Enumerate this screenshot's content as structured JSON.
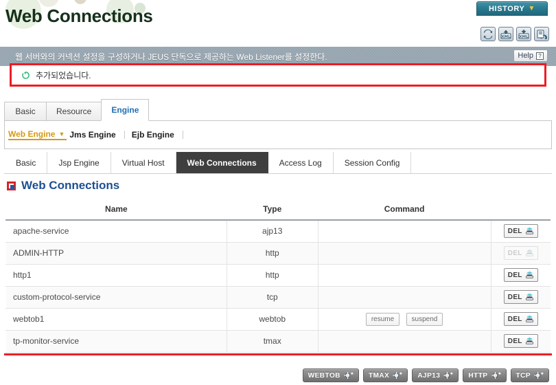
{
  "header": {
    "title": "Web Connections",
    "history_label": "HISTORY",
    "history_caret": "▼",
    "toolbar_icons": [
      {
        "name": "refresh-icon",
        "title": "refresh"
      },
      {
        "name": "xml-import-icon",
        "title": "XML import"
      },
      {
        "name": "xml-export-icon",
        "title": "XML export"
      },
      {
        "name": "apply-changes-icon",
        "title": "apply"
      }
    ]
  },
  "description": {
    "text": "웹 서버와의 커넥션 설정을 구성하거나 JEUS 단독으로 제공하는 Web Listener를 설정한다.",
    "help_label": "Help",
    "help_glyph": "?"
  },
  "alert": {
    "icon": "refresh-success-icon",
    "message": "추가되었습니다.",
    "border_color": "#ee1c24"
  },
  "tabs_level1": [
    {
      "label": "Basic",
      "active": false
    },
    {
      "label": "Resource",
      "active": false
    },
    {
      "label": "Engine",
      "active": true
    }
  ],
  "subnav": [
    {
      "label": "Web Engine",
      "active": true
    },
    {
      "label": "Jms Engine",
      "active": false
    },
    {
      "label": "Ejb Engine",
      "active": false
    }
  ],
  "tabs_level2": [
    {
      "label": "Basic",
      "active": false
    },
    {
      "label": "Jsp Engine",
      "active": false
    },
    {
      "label": "Virtual Host",
      "active": false
    },
    {
      "label": "Web Connections",
      "active": true
    },
    {
      "label": "Access Log",
      "active": false
    },
    {
      "label": "Session Config",
      "active": false
    }
  ],
  "section": {
    "title": "Web Connections",
    "icon": "section-marker-icon",
    "title_color": "#1e4f91"
  },
  "table": {
    "columns": [
      "Name",
      "Type",
      "Command",
      ""
    ],
    "delete_label": "DEL",
    "rows": [
      {
        "name": "apache-service",
        "type": "ajp13",
        "commands": [],
        "del_enabled": true
      },
      {
        "name": "ADMIN-HTTP",
        "type": "http",
        "commands": [],
        "del_enabled": false
      },
      {
        "name": "http1",
        "type": "http",
        "commands": [],
        "del_enabled": true
      },
      {
        "name": "custom-protocol-service",
        "type": "tcp",
        "commands": [],
        "del_enabled": true
      },
      {
        "name": "webtob1",
        "type": "webtob",
        "commands": [
          "resume",
          "suspend"
        ],
        "del_enabled": true
      },
      {
        "name": "tp-monitor-service",
        "type": "tmax",
        "commands": [],
        "del_enabled": true
      }
    ]
  },
  "bottom_actions": [
    {
      "label": "WEBTOB",
      "icon": "add-listener-icon"
    },
    {
      "label": "TMAX",
      "icon": "add-listener-icon"
    },
    {
      "label": "AJP13",
      "icon": "add-listener-icon"
    },
    {
      "label": "HTTP",
      "icon": "add-listener-icon"
    },
    {
      "label": "TCP",
      "icon": "add-listener-icon"
    }
  ]
}
